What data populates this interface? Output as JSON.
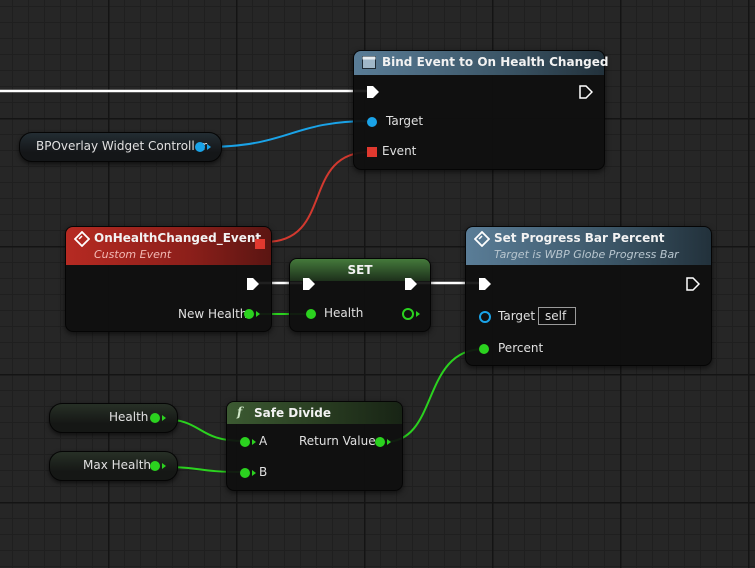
{
  "colors": {
    "exec_wire": "#ffffff",
    "object_wire": "#1aa3e8",
    "delegate_wire": "#d2392f",
    "float_wire": "#2bd21f",
    "event_header": "#a5221c",
    "function_header": "#4c6f88",
    "set_header": "#3a6a34"
  },
  "controller_var": {
    "label": "BPOverlay Widget Controller",
    "pin_icon": "object-pin-icon"
  },
  "bind_event": {
    "title": "Bind Event to On Health Changed",
    "header_icon": "function-icon",
    "target_label": "Target",
    "event_label": "Event"
  },
  "health_event": {
    "title": "OnHealthChanged_Event",
    "subtitle": "Custom Event",
    "header_icon": "event-diamond-icon",
    "new_health_label": "New Health"
  },
  "set_node": {
    "title": "SET",
    "health_label": "Health"
  },
  "progress_bar": {
    "title": "Set Progress Bar Percent",
    "subtitle": "Target is WBP Globe Progress Bar",
    "header_icon": "function-diamond-icon",
    "target_label": "Target",
    "target_default": "self",
    "percent_label": "Percent"
  },
  "health_var": {
    "label": "Health"
  },
  "max_health_var": {
    "label": "Max Health"
  },
  "safe_divide": {
    "title": "Safe Divide",
    "header_icon": "f",
    "a_label": "A",
    "b_label": "B",
    "return_label": "Return Value"
  }
}
